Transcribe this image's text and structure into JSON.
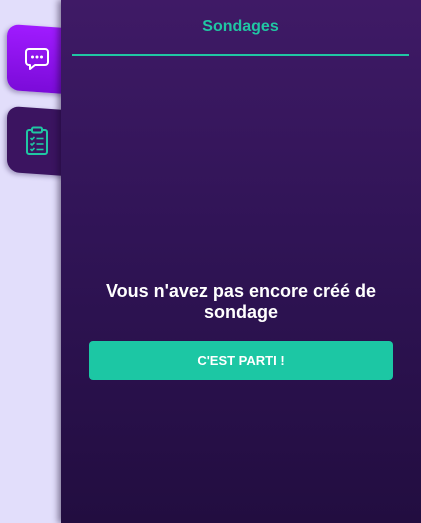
{
  "sidebar": {
    "tabs": [
      {
        "id": "chat",
        "icon": "chat-bubble-icon",
        "active": false
      },
      {
        "id": "polls",
        "icon": "clipboard-checklist-icon",
        "active": true
      }
    ]
  },
  "panel": {
    "title": "Sondages",
    "empty_message": "Vous n'avez pas encore créé de sondage",
    "start_button_label": "C'EST PARTI !"
  },
  "colors": {
    "accent": "#1cc7a4",
    "panel_background": "#301456",
    "chat_tab": "#8e12ee",
    "page_background": "#e2defb"
  }
}
